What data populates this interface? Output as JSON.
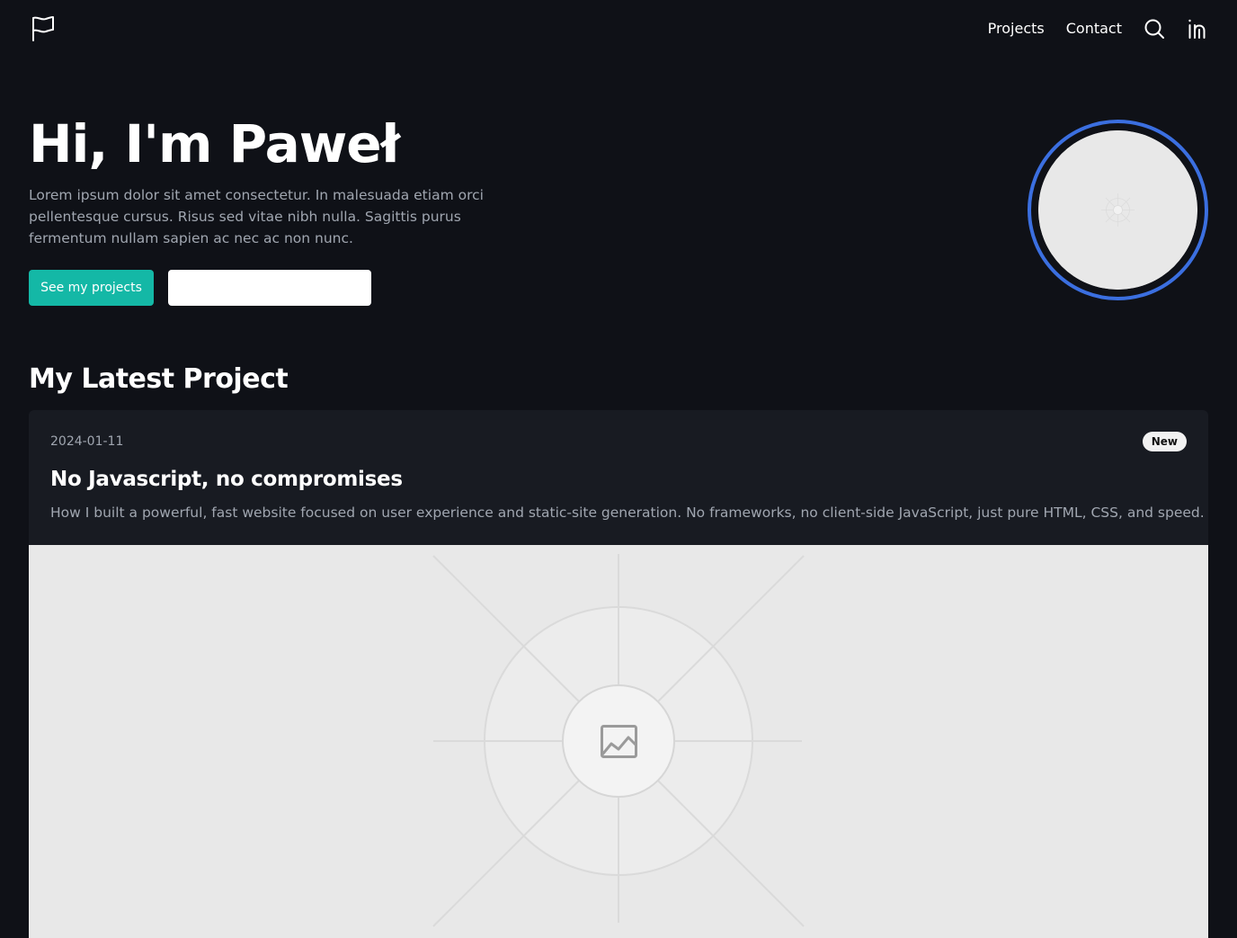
{
  "header": {
    "logo_icon": "flag-icon",
    "nav": [
      {
        "label": "Projects"
      },
      {
        "label": "Contact"
      }
    ],
    "search_icon": "search-icon",
    "social_icon": "linkedin-icon"
  },
  "hero": {
    "title": "Hi, I'm Paweł",
    "description": "Lorem ipsum dolor sit amet consectetur. In malesuada etiam orci pellentesque cursus. Risus sed vitae nibh nulla. Sagittis purus fermentum nullam sapien ac nec ac non nunc.",
    "primary_button": "See my projects",
    "secondary_button": "",
    "avatar_ring_color": "#3b6fe0"
  },
  "latest": {
    "section_title": "My Latest Project",
    "project": {
      "date": "2024-01-11",
      "badge": "New",
      "title": "No Javascript, no compromises",
      "description": "How I built a powerful, fast website focused on user experience and static-site generation. No frameworks, no client-side JavaScript, just pure HTML, CSS, and speed.",
      "image_icon": "image-placeholder-icon"
    }
  },
  "colors": {
    "background": "#0f1117",
    "card": "#181b22",
    "accent": "#14b8a6",
    "muted_text": "#a0a6b0"
  }
}
